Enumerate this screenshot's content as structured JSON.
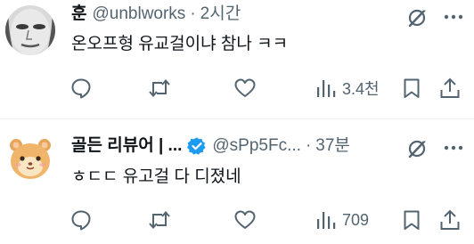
{
  "tweets": [
    {
      "display_name": "훈",
      "handle": "@unblworks",
      "separator": "·",
      "time": "2시간",
      "text": "온오프형 유교걸이냐 참나 ㅋㅋ",
      "views": "3.4천",
      "verified": false
    },
    {
      "display_name": "골든 리뷰어 | ...",
      "handle": "@sPp5Fc...",
      "separator": "·",
      "time": "37분",
      "text": "ㅎㄷㄷ 유고걸 다 디졌네",
      "views": "709",
      "verified": true
    }
  ],
  "colors": {
    "text_primary": "#0f1419",
    "text_secondary": "#536471",
    "verified_blue": "#1d9bf0",
    "divider": "#eff3f4"
  },
  "icons": {
    "actions": [
      "reply-icon",
      "repost-icon",
      "like-icon",
      "views-icon",
      "bookmark-icon",
      "share-icon"
    ],
    "header": [
      "grok-icon",
      "more-icon",
      "verified-badge-icon"
    ]
  }
}
